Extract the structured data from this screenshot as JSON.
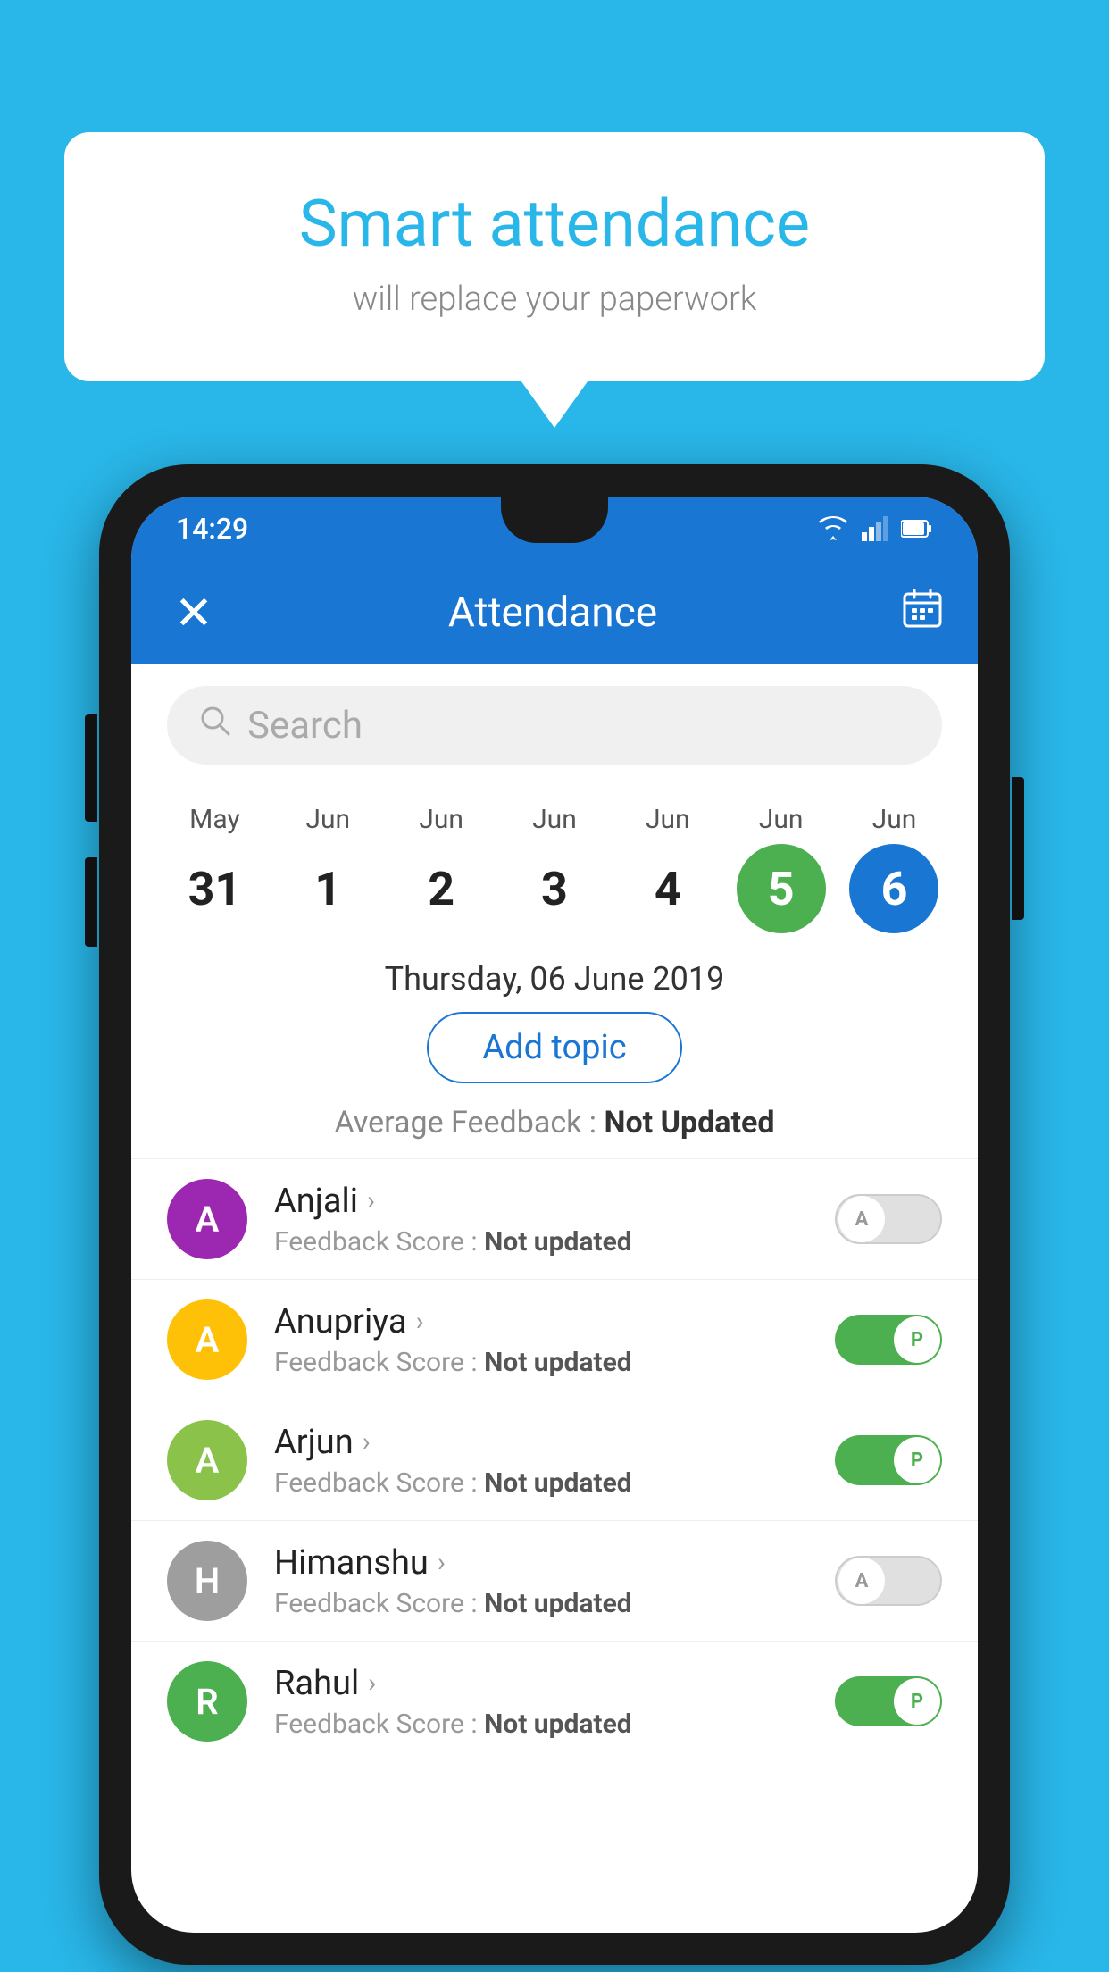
{
  "background_color": "#29B6E8",
  "speech_bubble": {
    "title": "Smart attendance",
    "subtitle": "will replace your paperwork"
  },
  "phone": {
    "status_bar": {
      "time": "14:29"
    },
    "app_bar": {
      "title": "Attendance",
      "close_label": "✕"
    },
    "search": {
      "placeholder": "Search"
    },
    "calendar": {
      "days": [
        {
          "month": "May",
          "num": "31",
          "state": "normal"
        },
        {
          "month": "Jun",
          "num": "1",
          "state": "normal"
        },
        {
          "month": "Jun",
          "num": "2",
          "state": "normal"
        },
        {
          "month": "Jun",
          "num": "3",
          "state": "normal"
        },
        {
          "month": "Jun",
          "num": "4",
          "state": "normal"
        },
        {
          "month": "Jun",
          "num": "5",
          "state": "today"
        },
        {
          "month": "Jun",
          "num": "6",
          "state": "selected"
        }
      ]
    },
    "date_display": "Thursday, 06 June 2019",
    "add_topic_label": "Add topic",
    "avg_feedback_label": "Average Feedback :",
    "avg_feedback_value": "Not Updated",
    "students": [
      {
        "name": "Anjali",
        "initial": "A",
        "avatar_color": "#9C27B0",
        "score_label": "Feedback Score :",
        "score_value": "Not updated",
        "attendance": "absent"
      },
      {
        "name": "Anupriya",
        "initial": "A",
        "avatar_color": "#FFC107",
        "score_label": "Feedback Score :",
        "score_value": "Not updated",
        "attendance": "present"
      },
      {
        "name": "Arjun",
        "initial": "A",
        "avatar_color": "#8BC34A",
        "score_label": "Feedback Score :",
        "score_value": "Not updated",
        "attendance": "present"
      },
      {
        "name": "Himanshu",
        "initial": "H",
        "avatar_color": "#9E9E9E",
        "score_label": "Feedback Score :",
        "score_value": "Not updated",
        "attendance": "absent"
      },
      {
        "name": "Rahul",
        "initial": "R",
        "avatar_color": "#4CAF50",
        "score_label": "Feedback Score :",
        "score_value": "Not updated",
        "attendance": "present"
      }
    ]
  }
}
